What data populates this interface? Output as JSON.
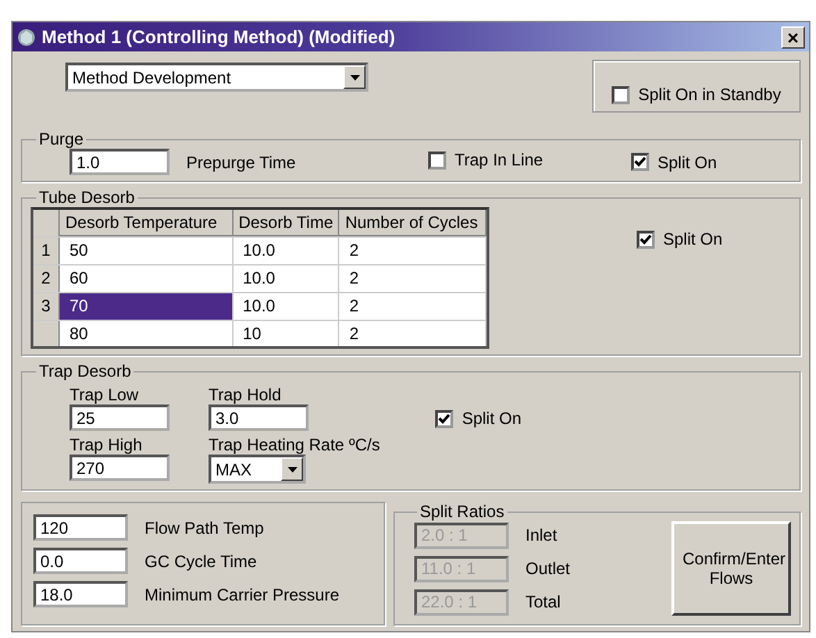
{
  "window": {
    "title": "Method  1 (Controlling Method) (Modified)",
    "close": "×"
  },
  "method_dropdown": {
    "value": "Method Development"
  },
  "standby": {
    "label": "Split On in Standby",
    "checked": false
  },
  "purge": {
    "title": "Purge",
    "prepurge": {
      "value": "1.0",
      "label": "Prepurge Time"
    },
    "checks": [
      {
        "label": "Trap In Line",
        "checked": false
      },
      {
        "label": "Split On",
        "checked": true
      }
    ]
  },
  "tube_desorb": {
    "title": "Tube Desorb",
    "columns": [
      "Desorb Temperature",
      "Desorb Time",
      "Number of Cycles"
    ],
    "rows": [
      {
        "number": "1",
        "cells": [
          "50",
          "10.0",
          "2"
        ],
        "selected": false
      },
      {
        "number": "2",
        "cells": [
          "60",
          "10.0",
          "2"
        ],
        "selected": false
      },
      {
        "number": "3",
        "cells": [
          "70",
          "10.0",
          "2"
        ],
        "selected": true
      },
      {
        "cells": [
          "80",
          "10",
          "2"
        ],
        "selected": false
      }
    ],
    "split_on": {
      "label": "Split On",
      "checked": true
    }
  },
  "trap_desorb": {
    "title": "Trap Desorb",
    "trap_low": {
      "label": "Trap Low",
      "value": "25"
    },
    "trap_hold": {
      "label": "Trap Hold",
      "value": "3.0"
    },
    "trap_high": {
      "label": "Trap High",
      "value": "270"
    },
    "heating_rate": {
      "label": "Trap Heating Rate ºC/s",
      "value": "MAX"
    },
    "split_on": {
      "label": "Split On",
      "checked": true
    }
  },
  "settings": [
    {
      "value": "120",
      "label": "Flow Path Temp"
    },
    {
      "value": "0.0",
      "label": "GC Cycle Time"
    },
    {
      "value": "18.0",
      "label": "Minimum Carrier Pressure"
    }
  ],
  "split_ratios": {
    "title": "Split Ratios",
    "items": [
      {
        "value": "2.0 : 1",
        "label": "Inlet",
        "disabled": true
      },
      {
        "value": "11.0 : 1",
        "label": "Outlet",
        "disabled": true
      },
      {
        "value": "22.0 : 1",
        "label": "Total",
        "disabled": true
      }
    ]
  },
  "confirm_button": "Confirm/Enter Flows"
}
